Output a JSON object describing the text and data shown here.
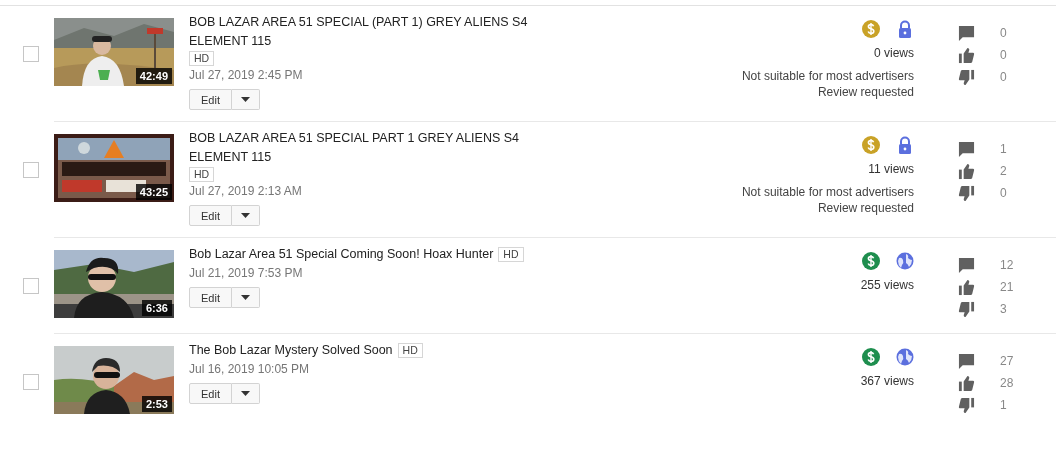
{
  "videos": [
    {
      "checked": false,
      "duration": "42:49",
      "title": "BOB LAZAR AREA 51 SPECIAL (PART 1) GREY ALIENS S4 ELEMENT 115",
      "hd": "HD",
      "date": "Jul 27, 2019 2:45 PM",
      "edit": "Edit",
      "ads_limited": true,
      "private": true,
      "views": "0 views",
      "notes": [
        "Not suitable for most advertisers",
        "Review requested"
      ],
      "comments": "0",
      "likes": "0",
      "dislikes": "0"
    },
    {
      "checked": false,
      "duration": "43:25",
      "title": "BOB LAZAR AREA 51 SPECIAL PART 1 GREY ALIENS S4 ELEMENT 115",
      "hd": "HD",
      "date": "Jul 27, 2019 2:13 AM",
      "edit": "Edit",
      "ads_limited": true,
      "private": true,
      "views": "11 views",
      "notes": [
        "Not suitable for most advertisers",
        "Review requested"
      ],
      "comments": "1",
      "likes": "2",
      "dislikes": "0"
    },
    {
      "checked": false,
      "duration": "6:36",
      "title": "Bob Lazar Area 51 Special Coming Soon! Hoax Hunter",
      "hd": "HD",
      "date": "Jul 21, 2019 7:53 PM",
      "edit": "Edit",
      "ads_limited": false,
      "private": false,
      "views": "255 views",
      "comments": "12",
      "likes": "21",
      "dislikes": "3"
    },
    {
      "checked": false,
      "duration": "2:53",
      "title": "The Bob Lazar Mystery Solved Soon",
      "hd": "HD",
      "date": "Jul 16, 2019 10:05 PM",
      "edit": "Edit",
      "ads_limited": false,
      "private": false,
      "views": "367 views",
      "comments": "27",
      "likes": "28",
      "dislikes": "1"
    }
  ]
}
